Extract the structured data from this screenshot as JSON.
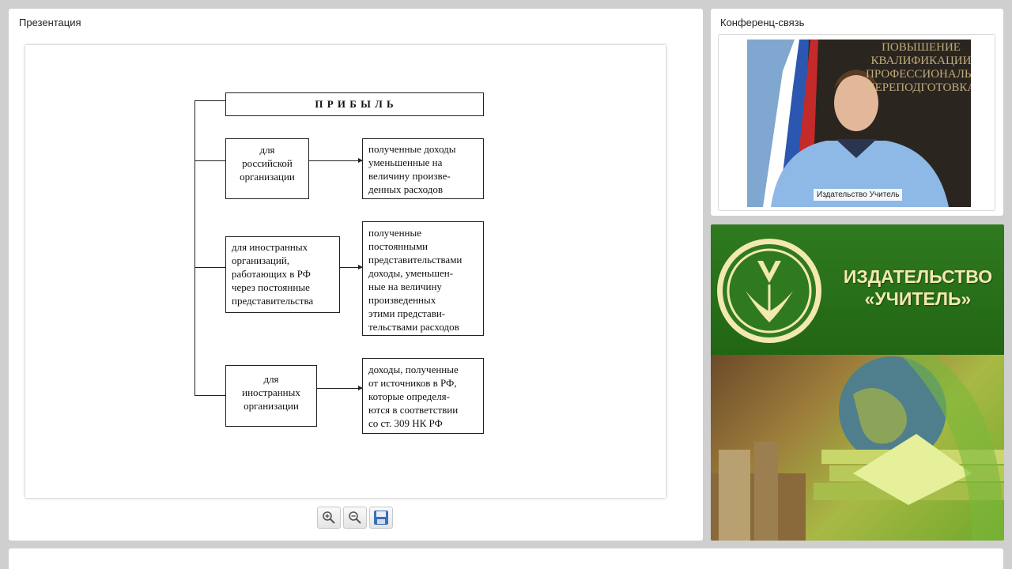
{
  "presentation": {
    "title": "Презентация",
    "slide": {
      "header": "П Р И Б Ы Л Ь",
      "rows": [
        {
          "left": "для\nроссийской\nорганизации",
          "right": "полученные доходы\nуменьшенные на\nвеличину произве-\nденных расходов"
        },
        {
          "left": "для иностранных\nорганизаций,\nработающих в РФ\nчерез постоянные\nпредставительства",
          "right": "полученные\nпостоянными\nпредставительствами\nдоходы, уменьшен-\nные на величину\nпроизведенных\nэтими представи-\nтельствами расходов"
        },
        {
          "left": "для\nиностранных\nорганизации",
          "right": "доходы, полученные\nот источников в РФ,\nкоторые определя-\nются в соответствии\nсо ст. 309 НК РФ"
        }
      ]
    },
    "toolbar": {
      "zoom_in_icon": "zoom-in-icon",
      "zoom_out_icon": "zoom-out-icon",
      "save_icon": "floppy-disk-icon"
    }
  },
  "conference": {
    "title": "Конференц-связь",
    "video_label": "Издательство Учитель",
    "banner_text": "ПОВЫШЕНИЕ\nКВАЛИФИКАЦИИ\nПРОФЕССИОНАЛЬНАЯ\nПЕРЕПОДГОТОВКА"
  },
  "publisher": {
    "name": "ИЗДАТЕЛЬСТВО\n«УЧИТЕЛЬ»",
    "colors": {
      "green": "#2f7a1f",
      "text": "#f2e8b0"
    }
  }
}
